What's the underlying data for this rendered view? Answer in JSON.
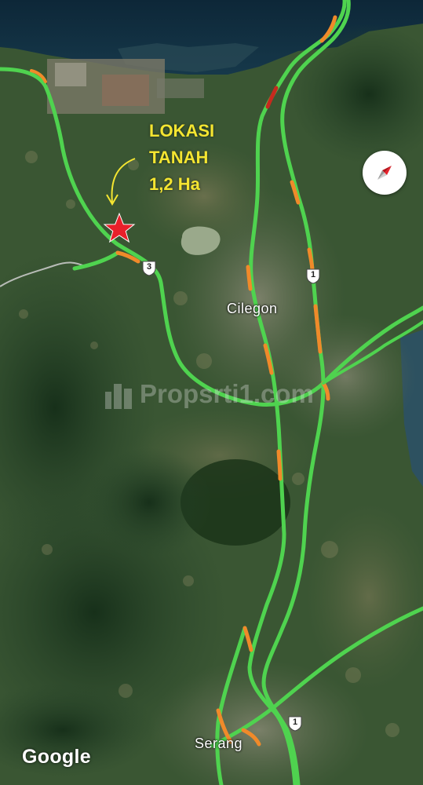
{
  "map": {
    "places": {
      "cilegon": "Cilegon",
      "serang": "Serang"
    },
    "annotation": {
      "line1": "LOKASI",
      "line2": "TANAH",
      "line3": "1,2 Ha"
    },
    "route_shields": {
      "route_3": "3",
      "route_1_north": "1",
      "route_1_south": "1"
    },
    "compass_icon": "compass-icon",
    "marker_icon": "star-marker-icon",
    "logo": "Google",
    "watermark": "Propsrti1.com",
    "colors": {
      "road_traffic_clear": "#4fd34f",
      "road_traffic_slow": "#f08a2a",
      "road_traffic_jam": "#c62a1e",
      "marker": "#e8202a",
      "annotation_text": "#f4e531",
      "sea": "#0f2a3a"
    }
  }
}
